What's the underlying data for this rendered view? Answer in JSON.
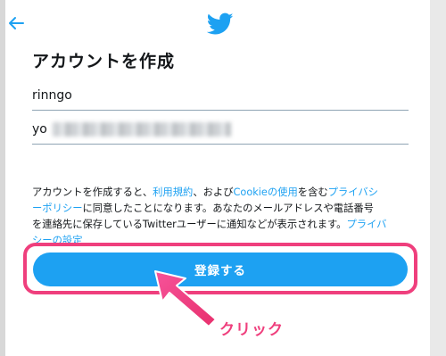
{
  "header": {
    "back_icon": "back-arrow-icon",
    "logo_icon": "twitter-bird-icon",
    "accent": "#1da1f2"
  },
  "title": "アカウントを作成",
  "form": {
    "name_value": "rinngo",
    "email_value": "yo"
  },
  "terms": {
    "l1_a": "アカウントを作成すると、",
    "l1_link1": "利用規約",
    "l1_b": "、および",
    "l1_link2": "Cookieの使用",
    "l1_c": "を含む",
    "l1_link3": "プライバシ",
    "l2_link": "ーポリシー",
    "l2_b": "に同意したことになります。あなたのメールアドレスや電話番号",
    "l3_a": "を連絡先に保存しているTwitterユーザーに通知などが表示されます。",
    "l3_link": "プライバ",
    "l4_link": "シーの設定"
  },
  "cta": {
    "label": "登録する"
  },
  "annotation": {
    "label": "クリック",
    "color": "#ef3f7d"
  }
}
